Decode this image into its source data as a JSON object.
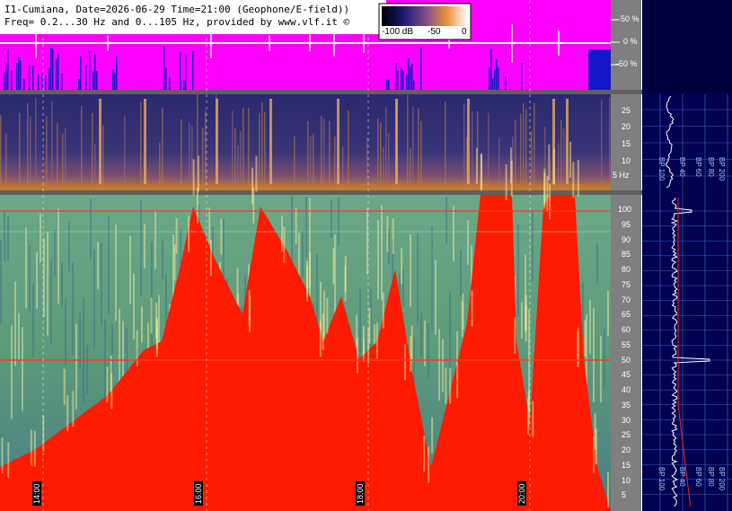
{
  "header": {
    "line1": "I1-Cumiana, Date=2026-06-29 Time=21:00 (Geophone/E-field))",
    "line2": "Freq= 0.2...30 Hz and 0...105 Hz, provided by www.vlf.it ©"
  },
  "colorbar": {
    "labels": [
      "-100 dB",
      "-50",
      "0"
    ]
  },
  "waveform_axis": {
    "ticks": [
      "50 %",
      "0 %",
      "-50 %"
    ]
  },
  "low_freq_axis": {
    "ticks": [
      "25",
      "20",
      "15",
      "10",
      "5 Hz"
    ]
  },
  "high_freq_axis": {
    "ticks": [
      "100",
      "95",
      "90",
      "85",
      "80",
      "75",
      "70",
      "65",
      "60",
      "55",
      "50",
      "45",
      "40",
      "35",
      "30",
      "25",
      "20",
      "15",
      "10",
      "5"
    ]
  },
  "time_axis": {
    "labels": [
      "14:00",
      "16:00",
      "18:00",
      "20:00"
    ]
  },
  "side_panel": {
    "bp_labels": [
      "BP 100",
      "BP 40",
      "BP 60",
      "BP 80",
      "BP 200"
    ]
  },
  "colors": {
    "waveform_bg": "#ff00ff",
    "waveform_bars": "#1414c8",
    "spectrogram_red": "#ff1a00",
    "spectrogram_green": "#5fa07a",
    "side_panel_bg": "#000050",
    "axis_bg": "#7f7f7f"
  }
}
